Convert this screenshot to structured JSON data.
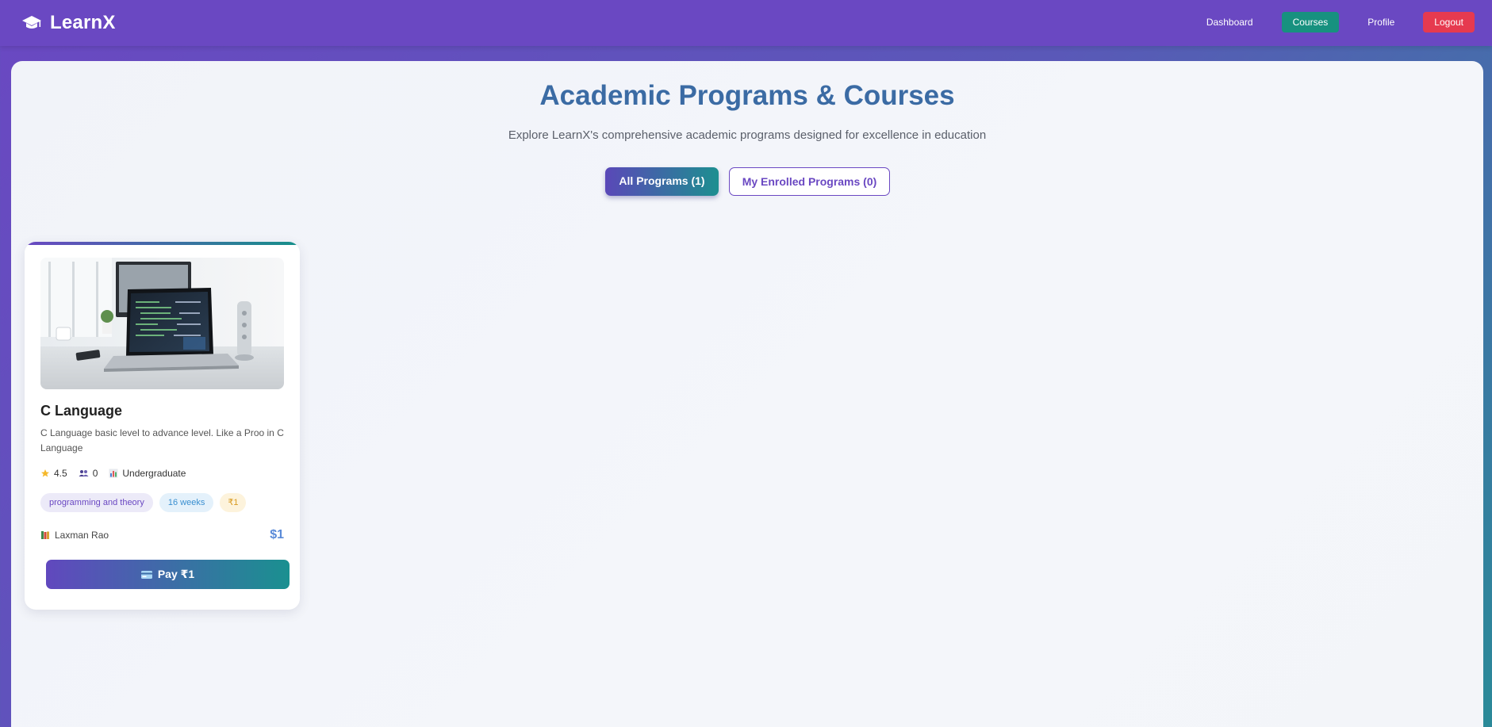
{
  "navbar": {
    "brand_name": "LearnX",
    "links": [
      {
        "label": "Dashboard"
      },
      {
        "label": "Courses"
      },
      {
        "label": "Profile"
      },
      {
        "label": "Logout"
      }
    ],
    "active_link": "Courses",
    "colors": {
      "navbar": "#6a48c2",
      "active": "#17917f",
      "logout": "#e63a4f"
    }
  },
  "main": {
    "title": "Academic Programs & Courses",
    "subtitle": "Explore LearnX's comprehensive academic programs designed for excellence in education",
    "tabs": [
      {
        "label": "All Programs (1)",
        "active": true
      },
      {
        "label": "My Enrolled Programs (0)",
        "active": false
      }
    ]
  },
  "course": {
    "title": "C Language",
    "description": "C Language basic level to advance level. Like a Proo in C Language",
    "rating": "4.5",
    "students": "0",
    "level": "Undergraduate",
    "tags": {
      "category": "programming and theory",
      "duration": "16 weeks",
      "price": "₹1"
    },
    "instructor": "Laxman Rao",
    "price": "$1",
    "pay_label": "Pay ₹1",
    "icons": [
      "star-icon",
      "students-icon",
      "level-chart-icon",
      "instructor-books-icon",
      "credit-card-icon"
    ]
  }
}
